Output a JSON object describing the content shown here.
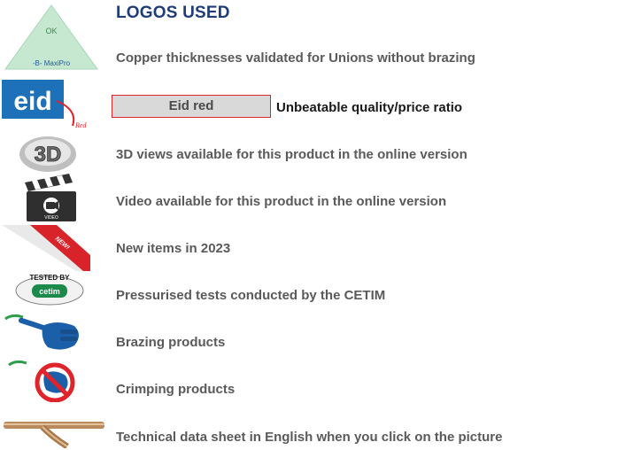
{
  "header": {
    "title": "LOGOS USED"
  },
  "logos": {
    "maxipro": {
      "ok_text": "OK",
      "brand_text": "-B- MaxiPro",
      "icon": "maxipro-triangle-icon"
    },
    "eid": {
      "text": "eid",
      "sub_text": "Red",
      "icon": "eid-red-logo"
    },
    "view3d": {
      "text": "3D",
      "icon": "3d-view-icon"
    },
    "video": {
      "text": "VIDEO",
      "icon": "video-clapperboard-icon"
    },
    "new": {
      "text": "NEW!",
      "icon": "new-corner-ribbon-icon"
    },
    "cetim": {
      "tested_text": "TESTED BY",
      "brand_text": "cetim",
      "icon": "cetim-seal-icon"
    },
    "brazing": {
      "icon": "brazing-hand-torch-icon"
    },
    "crimping": {
      "icon": "crimping-no-torch-icon"
    },
    "datasheet": {
      "icon": "fitting-picture-icon"
    }
  },
  "rows": {
    "maxipro": "Copper thicknesses validated for Unions without brazing",
    "eid_badge": "Eid red",
    "eid": "Unbeatable quality/price ratio",
    "view3d": "3D views available for this product in the online version",
    "video": "Video available for this product in the online version",
    "new": "New items in 2023",
    "cetim": "Pressurised tests conducted by the CETIM",
    "brazing": "Brazing products",
    "crimping": "Crimping products",
    "datasheet": "Technical data sheet in English when you click on the picture"
  },
  "colors": {
    "title": "#1f3d78",
    "text": "#5a5a5a",
    "eid_blue": "#1d71b8",
    "eid_red": "#e0242b",
    "badge_bg": "#d9d9d9",
    "maxipro_green": "#c6e8d0",
    "new_red": "#d8232a",
    "hand_blue": "#1b5fa8"
  }
}
